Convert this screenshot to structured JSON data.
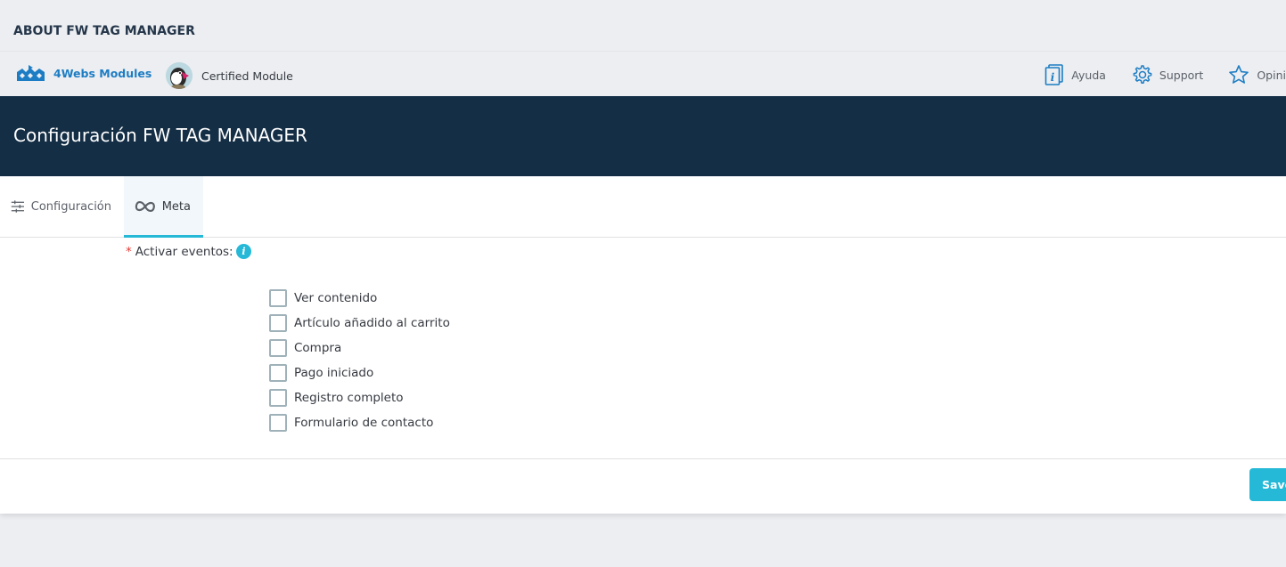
{
  "about": {
    "title": "ABOUT FW TAG MANAGER"
  },
  "brand": {
    "vendor_label": "4Webs Modules",
    "vendor_icon": "4webs-logo-icon",
    "certified_label": "Certified Module",
    "certified_icon": "prestashop-puffin-avatar"
  },
  "top_links": [
    {
      "label": "Ayuda",
      "icon": "info-book-icon"
    },
    {
      "label": "Support",
      "icon": "gear-icon"
    },
    {
      "label": "Opini",
      "icon": "star-icon"
    }
  ],
  "header": {
    "title": "Configuración FW TAG MANAGER"
  },
  "tabs": [
    {
      "label": "Configuración",
      "icon": "sliders-icon",
      "active": false
    },
    {
      "label": "Meta",
      "icon": "meta-infinity-icon",
      "active": true
    }
  ],
  "form": {
    "required_marker": "*",
    "field_label": "Activar eventos:",
    "help_glyph": "i",
    "options": [
      {
        "label": "Ver contenido",
        "checked": false
      },
      {
        "label": "Artículo añadido al carrito",
        "checked": false
      },
      {
        "label": "Compra",
        "checked": false
      },
      {
        "label": "Pago iniciado",
        "checked": false
      },
      {
        "label": "Registro completo",
        "checked": false
      },
      {
        "label": "Formulario de contacto",
        "checked": false
      }
    ]
  },
  "footer": {
    "save_label": "Save"
  },
  "colors": {
    "accent": "#25b9d7",
    "header_bg": "#142e45",
    "vendor_blue": "#1d7dc4",
    "page_bg": "#eceef1",
    "required": "#e53935"
  }
}
